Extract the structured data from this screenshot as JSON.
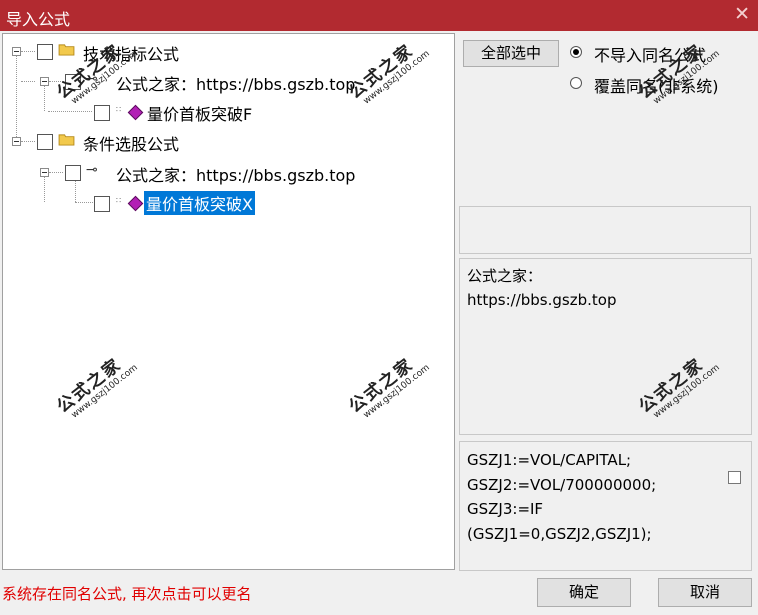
{
  "window": {
    "title": "导入公式",
    "close_glyph": "✕"
  },
  "tree": {
    "nodes": [
      {
        "label": "技术指标公式"
      },
      {
        "label": "公式之家：https://bbs.gszb.top"
      },
      {
        "label": "量价首板突破F"
      },
      {
        "label": "条件选股公式"
      },
      {
        "label": "公式之家：https://bbs.gszb.top"
      },
      {
        "label": "量价首板突破X",
        "selected": true
      }
    ]
  },
  "options": {
    "select_all_label": "全部选中",
    "radio_no_import": "不导入同名公式",
    "radio_overwrite": "覆盖同名(非系统)",
    "selected_radio": "radio_no_import"
  },
  "info": {
    "line1": "公式之家：",
    "line2": "https://bbs.gszb.top"
  },
  "code": {
    "lines": [
      "GSZJ1:=VOL/CAPITAL;",
      "GSZJ2:=VOL/700000000;",
      "GSZJ3:=IF",
      "(GSZJ1=0,GSZJ2,GSZJ1);"
    ]
  },
  "footer": {
    "status": "系统存在同名公式, 再次点击可以更名",
    "ok_label": "确定",
    "cancel_label": "取消"
  },
  "watermark": {
    "brand": "公式之家",
    "url": "www.gszj100.com"
  },
  "colors": {
    "titlebar": "#b22a30",
    "selection": "#0078d7",
    "status_text": "#e00000",
    "gem": "#b21fb5",
    "folder": "#f2c94c"
  }
}
